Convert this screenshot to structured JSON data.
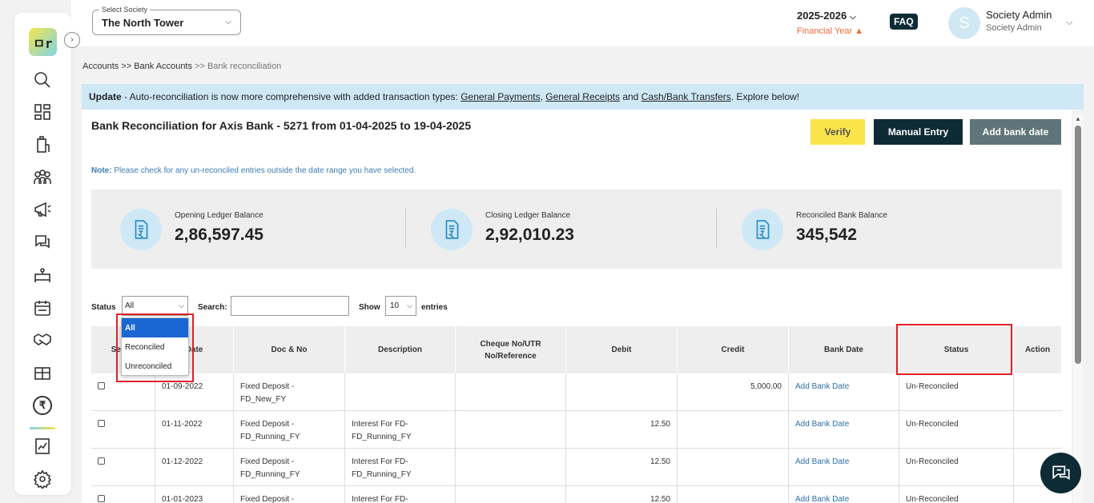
{
  "sidebar": {
    "logo_text": "ㅁr",
    "items": [
      "search-icon",
      "dashboard-icon",
      "building-icon",
      "members-icon",
      "announcement-icon",
      "chat-icon",
      "bed-icon",
      "calendar-icon",
      "handshake-icon",
      "box-icon",
      "rupee-icon",
      "report-icon",
      "settings-icon"
    ],
    "rupee_symbol": "₹"
  },
  "header": {
    "society_label": "Select Society",
    "society_value": "The North Tower",
    "year": "2025-2026",
    "year_sub": "Financial Year",
    "faq": "FAQ",
    "avatar_letter": "S",
    "user_name": "Society Admin",
    "user_role": "Society Admin"
  },
  "breadcrumb": {
    "accounts": "Accounts",
    "sep1": " >> ",
    "bank_accounts": "Bank Accounts",
    "sep2": " >> ",
    "current": "Bank reconciliation"
  },
  "banner": {
    "prefix": "Update",
    "text": " - Auto-reconciliation is now more comprehensive with added transaction types: ",
    "link1": "General Payments",
    "comma": ", ",
    "link2": "General Receipts",
    "and": " and ",
    "link3": "Cash/Bank Transfers",
    "suffix": ". Explore below!"
  },
  "page": {
    "title": "Bank Reconciliation for Axis Bank - 5271 from 01-04-2025 to 19-04-2025",
    "verify": "Verify",
    "manual_entry": "Manual Entry",
    "add_bank_date": "Add bank date",
    "note_label": "Note:",
    "note_text": " Please check for any un-reconciled entries outside the date range you have selected."
  },
  "balances": [
    {
      "label": "Opening Ledger Balance",
      "value": "2,86,597.45"
    },
    {
      "label": "Closing Ledger Balance",
      "value": "2,92,010.23"
    },
    {
      "label": "Reconciled Bank Balance",
      "value": "345,542"
    }
  ],
  "controls": {
    "status_label": "Status",
    "status_value": "All",
    "search_label": "Search:",
    "show_label": "Show",
    "show_value": "10",
    "entries_label": "entries"
  },
  "dropdown": {
    "options": [
      "All",
      "Reconciled",
      "Unreconciled"
    ]
  },
  "table": {
    "headers": [
      "Select",
      "Date",
      "Doc & No",
      "Description",
      "Cheque No/UTR No/Reference",
      "Debit",
      "Credit",
      "Bank Date",
      "Status",
      "Action"
    ],
    "rows": [
      {
        "date": "01-09-2022",
        "doc": "Fixed Deposit - FD_New_FY",
        "desc": "",
        "cheque": "",
        "debit": "",
        "credit": "5,000.00",
        "bank_date": "Add Bank Date",
        "status": "Un-Reconciled"
      },
      {
        "date": "01-11-2022",
        "doc": "Fixed Deposit - FD_Running_FY",
        "desc": "Interest For FD-FD_Running_FY",
        "cheque": "",
        "debit": "12.50",
        "credit": "",
        "bank_date": "Add Bank Date",
        "status": "Un-Reconciled"
      },
      {
        "date": "01-12-2022",
        "doc": "Fixed Deposit - FD_Running_FY",
        "desc": "Interest For FD-FD_Running_FY",
        "cheque": "",
        "debit": "12.50",
        "credit": "",
        "bank_date": "Add Bank Date",
        "status": "Un-Reconciled"
      },
      {
        "date": "01-01-2023",
        "doc": "Fixed Deposit -",
        "desc": "Interest For FD-",
        "cheque": "",
        "debit": "12.50",
        "credit": "",
        "bank_date": "Add Bank Date",
        "status": "Un-Reconciled"
      }
    ]
  },
  "colors": {
    "brand_dark": "#0d2b35",
    "verify_yellow": "#f9e54a",
    "highlight_red": "#e0202a",
    "link_blue": "#2e6fa8"
  }
}
